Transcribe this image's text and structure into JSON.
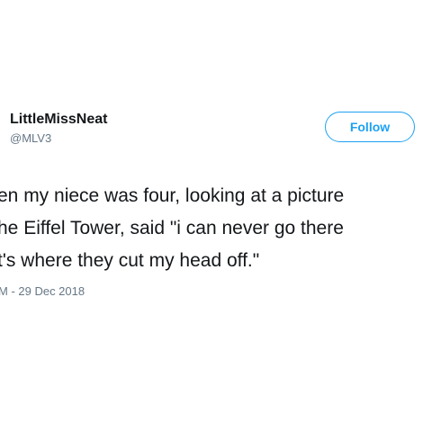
{
  "author": {
    "display_name": "LittleMissNeat",
    "handle": "@MLV3"
  },
  "follow_button": {
    "label": "Follow"
  },
  "tweet": {
    "lines": [
      "en my niece was four, looking at a picture",
      "he Eiffel Tower, said \"i can never go there",
      "t's where they cut my head off.\""
    ],
    "timestamp": "M - 29 Dec 2018"
  },
  "colors": {
    "accent": "#1da1f2",
    "text": "#14171a",
    "secondary_text": "#657786",
    "background": "#ffffff"
  }
}
